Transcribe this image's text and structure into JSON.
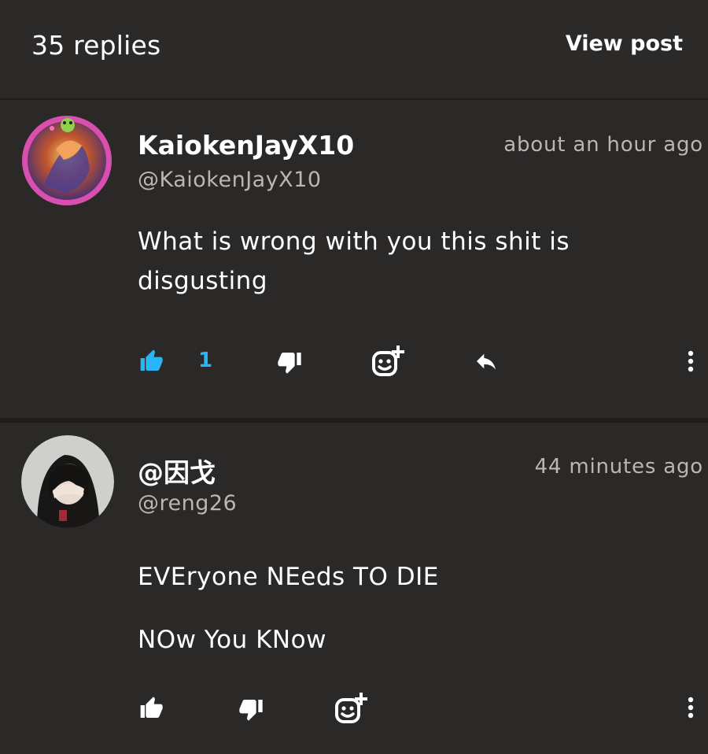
{
  "header": {
    "title": "35 replies",
    "view_post": "View post"
  },
  "comments": [
    {
      "username": "KaiokenJayX10",
      "handle": "@KaiokenJayX10",
      "time": "about an hour ago",
      "text_lines": [
        "What is wrong with you this shit is",
        "disgusting"
      ],
      "likes": "1",
      "liked": true
    },
    {
      "username": "@因戈",
      "handle": "@reng26",
      "time": "44 minutes ago",
      "text_lines": [
        "EVEryone NEeds TO DIE",
        "NOw You KNow"
      ],
      "liked": false
    }
  ],
  "icons": {
    "like": "thumbs-up-icon",
    "dislike": "thumbs-down-icon",
    "react": "add-reaction-icon",
    "reply": "reply-icon",
    "more": "more-vertical-icon"
  },
  "colors": {
    "background": "#2a2827",
    "accent": "#29b6f6",
    "muted_text": "#b9b6b3"
  }
}
